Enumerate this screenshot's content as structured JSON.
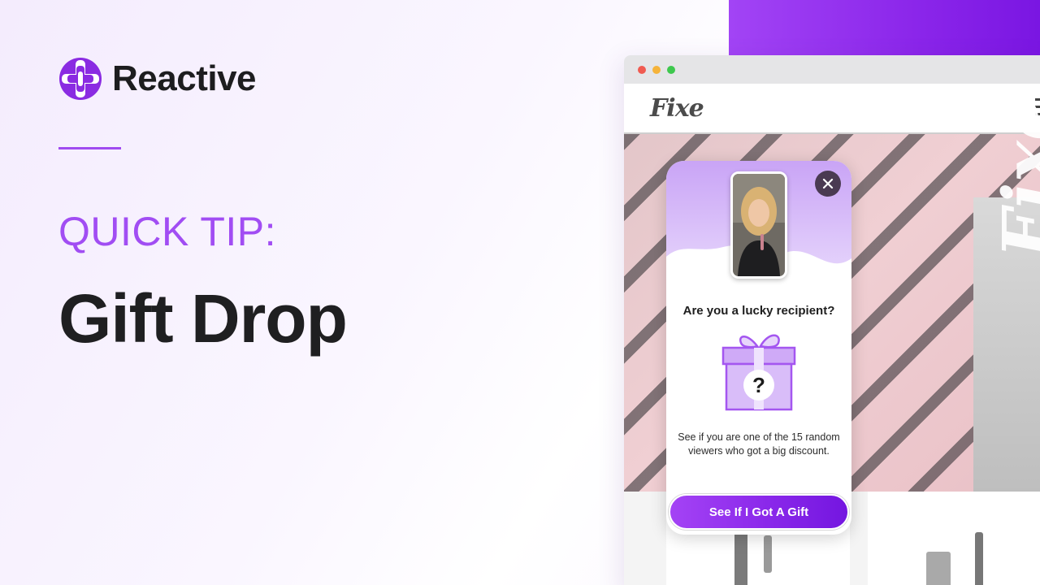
{
  "brand": {
    "name": "Reactive",
    "logo_icon": "reactive-logo-icon",
    "color": "#8a2be2"
  },
  "hero": {
    "tip_label": "QUICK TIP:",
    "title": "Gift Drop",
    "accent_color": "#a14df3"
  },
  "browser": {
    "window_controls": [
      "close-dot",
      "minimize-dot",
      "maximize-dot"
    ],
    "site": {
      "logo_text": "Fixe",
      "menu_icon": "hamburger-menu-icon",
      "banner_text": "Fixe"
    }
  },
  "popup": {
    "close_icon": "close-icon",
    "heading": "Are you a lucky recipient?",
    "gift_icon": "mystery-gift-icon",
    "gift_symbol": "?",
    "body": "See if you are one of the 15 random viewers who got a big discount.",
    "cta_label": "See If I Got A Gift",
    "cta_color": "#8a28ea"
  }
}
